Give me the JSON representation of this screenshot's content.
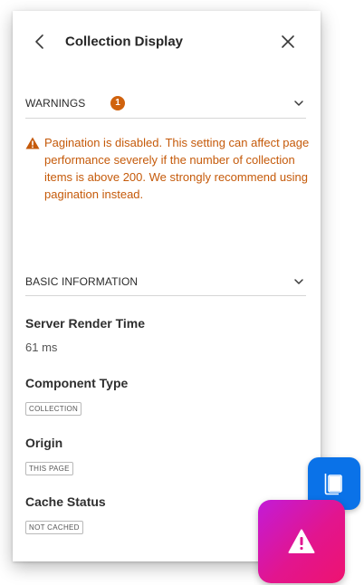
{
  "header": {
    "title": "Collection Display",
    "back_icon": "chevron-left-icon",
    "close_icon": "close-icon"
  },
  "warnings": {
    "title": "WARNINGS",
    "count": "1",
    "expand_icon": "chevron-down-icon",
    "message": "Pagination is disabled. This setting can affect page performance severely if the number of collection items is above 200. We strongly recommend using pagination instead.",
    "message_icon": "warning-triangle-icon",
    "accent_color": "#c55a0a"
  },
  "basic_info": {
    "title": "BASIC INFORMATION",
    "expand_icon": "chevron-down-icon",
    "fields": [
      {
        "label": "Server Render Time",
        "value": "61 ms"
      },
      {
        "label": "Component Type",
        "tag": "COLLECTION"
      },
      {
        "label": "Origin",
        "tag": "THIS PAGE"
      },
      {
        "label": "Cache Status",
        "tag": "NOT CACHED"
      }
    ]
  },
  "floating_buttons": {
    "doc_icon": "document-icon",
    "doc_color": "#0a72e8",
    "alert_icon": "warning-icon",
    "alert_gradient": [
      "#c21bd8",
      "#ee1370"
    ]
  }
}
